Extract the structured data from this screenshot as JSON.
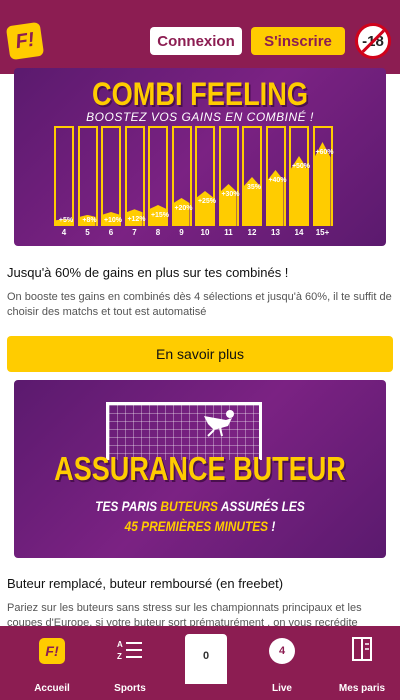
{
  "header": {
    "logo_text": "F!",
    "login_label": "Connexion",
    "signup_label": "S'inscrire",
    "age_badge": "-18"
  },
  "banner_combi": {
    "title": "COMBI FEELING",
    "subtitle": "BOOSTEZ VOS GAINS EN COMBINÉ !",
    "chart_data": {
      "type": "bar",
      "categories": [
        "4",
        "5",
        "6",
        "7",
        "8",
        "9",
        "10",
        "11",
        "12",
        "13",
        "14",
        "15+"
      ],
      "values": [
        5,
        8,
        10,
        12,
        15,
        20,
        25,
        30,
        35,
        40,
        50,
        60
      ],
      "value_labels": [
        "+5%",
        "+8%",
        "+10%",
        "+12%",
        "+15%",
        "+20%",
        "+25%",
        "+30%",
        "35%",
        "+40%",
        "+50%",
        "+60%"
      ],
      "title": "COMBI FEELING",
      "subtitle": "BOOSTEZ VOS GAINS EN COMBINÉ !",
      "xlabel": "",
      "ylabel": "",
      "ylim": [
        0,
        70
      ]
    }
  },
  "section1": {
    "title": "Jusqu'à 60% de gains en plus sur tes combinés !",
    "description": "On booste tes gains en combinés dès 4 sélections et jusqu'à 60%, il te suffit de choisir des matchs et tout est automatisé",
    "button_label": "En savoir plus"
  },
  "banner_buteur": {
    "title": "ASSURANCE BUTEUR",
    "line1_a": "TES PARIS ",
    "line1_hl": "BUTEURS",
    "line1_b": " ASSURÉS LES",
    "line2_hl": "45 PREMIÈRES MINUTES",
    "line2_b": " !"
  },
  "section2": {
    "title": "Buteur remplacé, buteur remboursé (en freebet)",
    "description": "Pariez sur les buteurs sans stress sur les championnats principaux et les coupes d'Europe, si votre buteur sort prématurément , on vous recrédite"
  },
  "bottom_nav": {
    "home_label": "Accueil",
    "home_logo": "F!",
    "sports_label": "Sports",
    "sports_icon_text": "A Z",
    "betslip_count": "0",
    "live_label": "Live",
    "live_count": "4",
    "my_bets_label": "Mes paris"
  },
  "colors": {
    "brand": "#8c1d52",
    "accent": "#ffcc00",
    "banner_bg": "#6b1f78"
  }
}
